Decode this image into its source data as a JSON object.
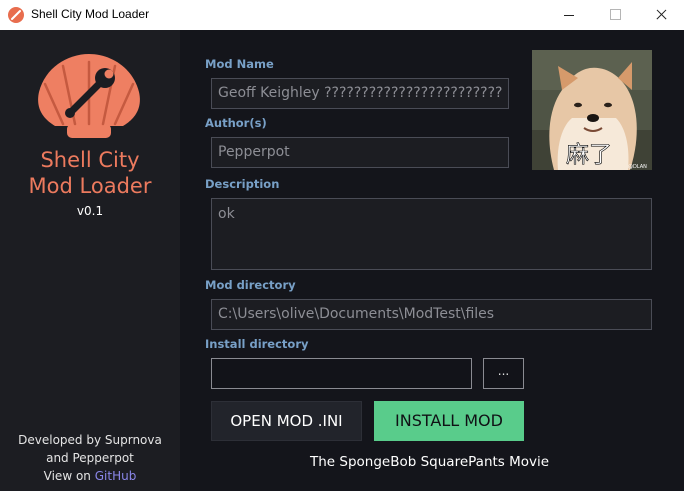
{
  "window": {
    "title": "Shell City Mod Loader"
  },
  "sidebar": {
    "brand_line1": "Shell City",
    "brand_line2": "Mod Loader",
    "version": "v0.1",
    "credit_line1": "Developed by Suprnova",
    "credit_line2": "and Pepperpot",
    "credit_view": "View on",
    "credit_link": "GitHub"
  },
  "form": {
    "mod_name": {
      "label": "Mod Name",
      "value": "Geoff Keighley ????????????????????????"
    },
    "authors": {
      "label": "Author(s)",
      "value": "Pepperpot"
    },
    "description": {
      "label": "Description",
      "value": "ok"
    },
    "mod_directory": {
      "label": "Mod directory",
      "value": "C:\\Users\\olive\\Documents\\ModTest\\files"
    },
    "install_directory": {
      "label": "Install directory",
      "value": ""
    }
  },
  "preview": {
    "caption": "麻了",
    "watermark": "@DLAN"
  },
  "buttons": {
    "browse": "...",
    "open_ini": "OPEN MOD .INI",
    "install": "INSTALL MOD"
  },
  "game_label": "The SpongeBob SquarePants Movie",
  "colors": {
    "accent_salmon": "#ec7a5e",
    "label_blue": "#78a0c7",
    "install_green": "#59cc8b",
    "link_purple": "#8b87ea"
  }
}
